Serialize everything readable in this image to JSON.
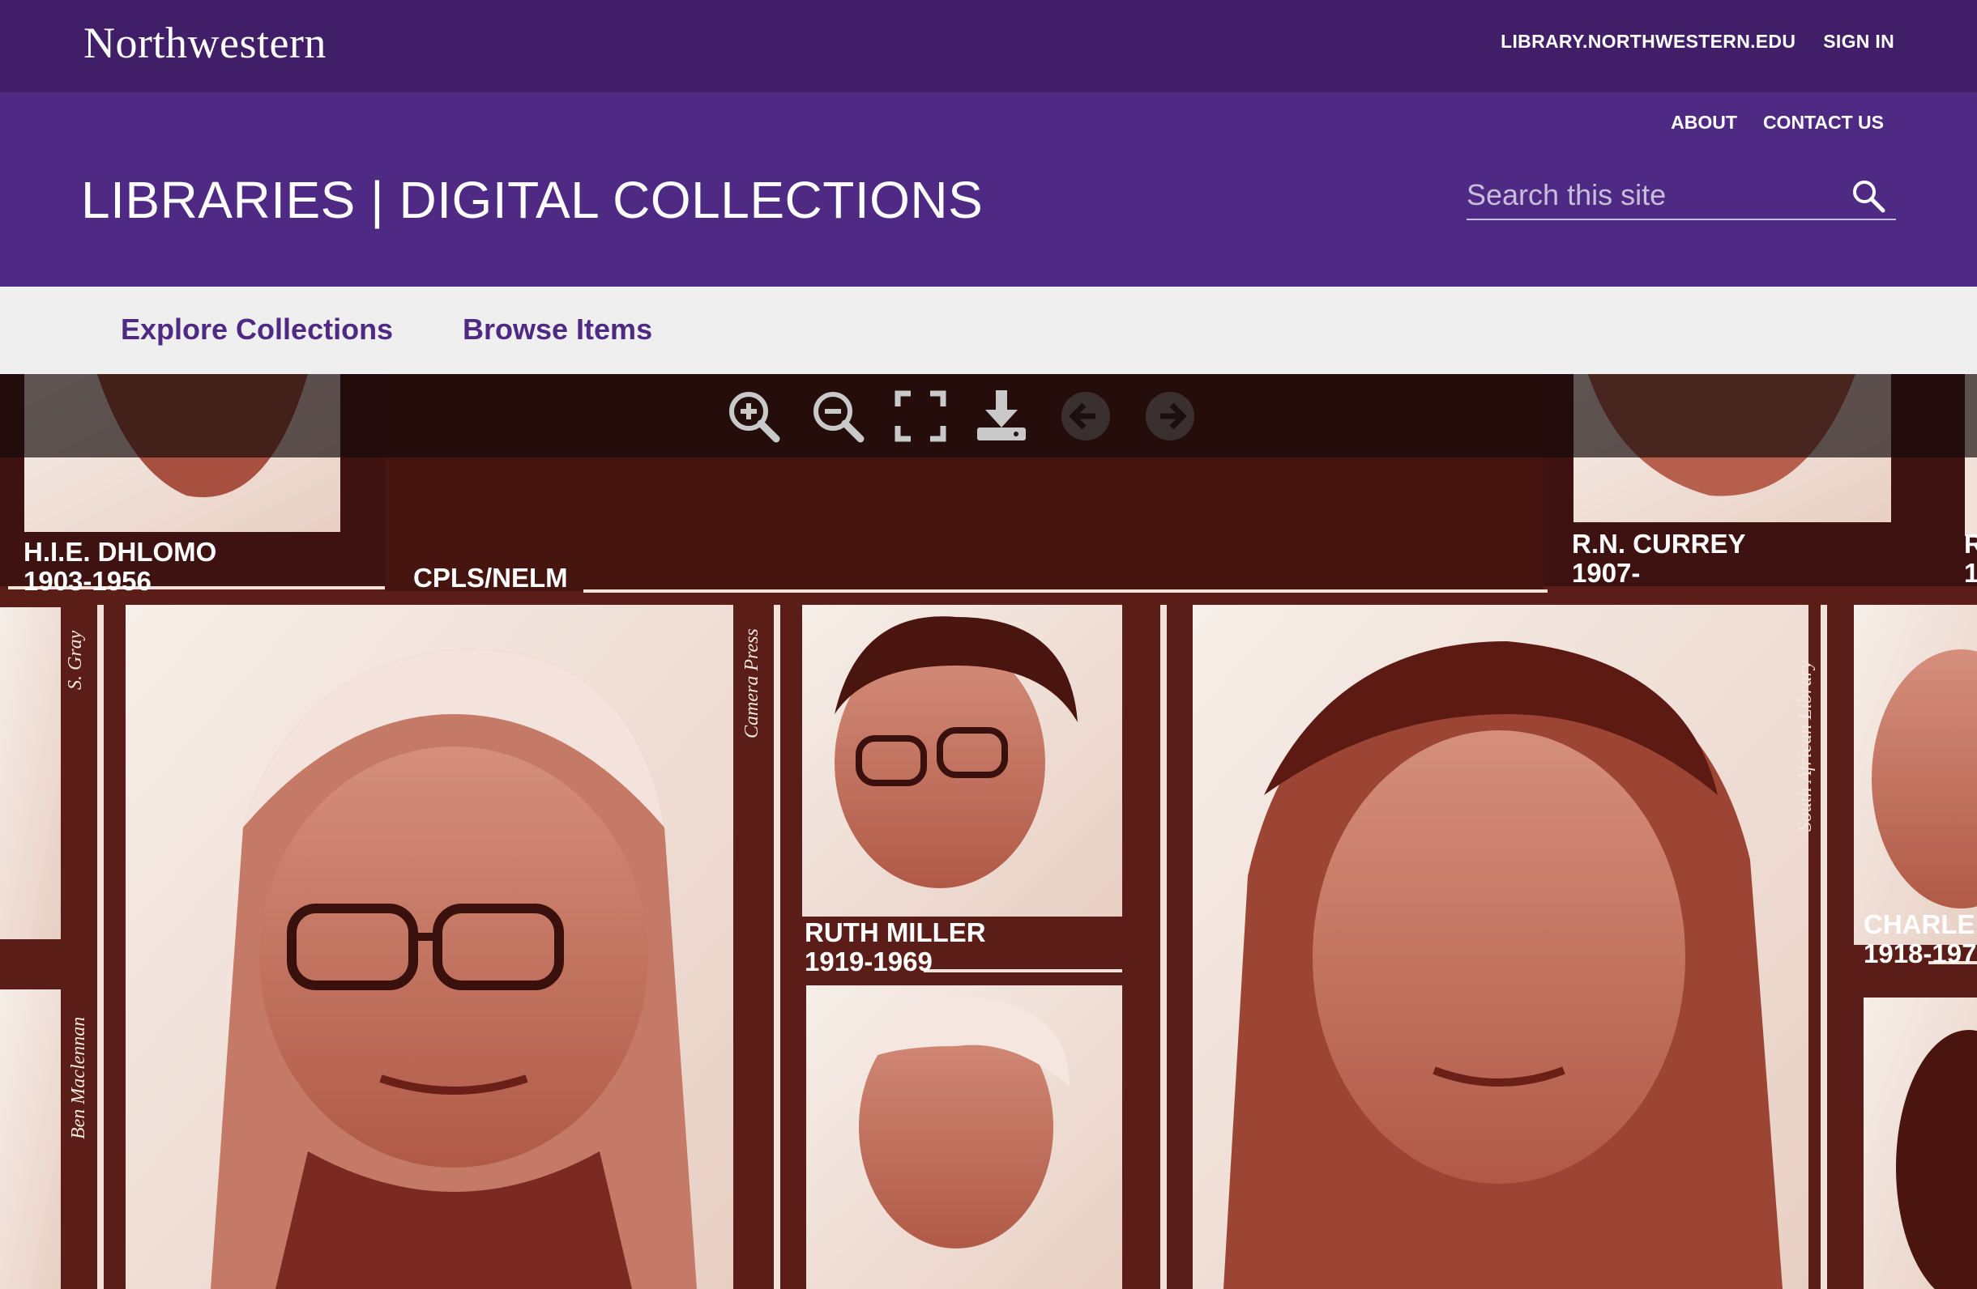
{
  "topbar": {
    "brand": "Northwestern",
    "link_library": "LIBRARY.NORTHWESTERN.EDU",
    "link_signin": "SIGN IN"
  },
  "header": {
    "about": "ABOUT",
    "contact": "CONTACT US",
    "title": "LIBRARIES | DIGITAL COLLECTIONS"
  },
  "search": {
    "placeholder": "Search this site"
  },
  "nav": {
    "explore": "Explore Collections",
    "browse": "Browse Items"
  },
  "viewer": {
    "toolbar": [
      "zoom-in-icon",
      "zoom-out-icon",
      "fullscreen-icon",
      "download-icon",
      "previous-icon",
      "next-icon"
    ],
    "labels": {
      "dhlomo_name": "H.I.E. DHLOMO",
      "dhlomo_years": "1903-1956",
      "cpls": "CPLS/NELM",
      "currey_name": "R.N. CURREY",
      "currey_years": "1907-",
      "ruth_name": "RUTH MILLER",
      "ruth_years": "1919-1969",
      "charle_name": "CHARLE",
      "charle_years": "1918-197",
      "edge_r": "R",
      "edge_1": "1"
    },
    "credits": {
      "gray": "S. Gray",
      "camera": "Camera Press",
      "sal": "South African Library",
      "maclennan": "Ben Maclennan"
    }
  },
  "colors": {
    "topbar": "#401f68",
    "header": "#4e2a84",
    "nav_bg": "#efefef",
    "nav_text": "#4e2a84",
    "photo_bg": "#5a1d17",
    "photo_tone": "#a8503f"
  }
}
